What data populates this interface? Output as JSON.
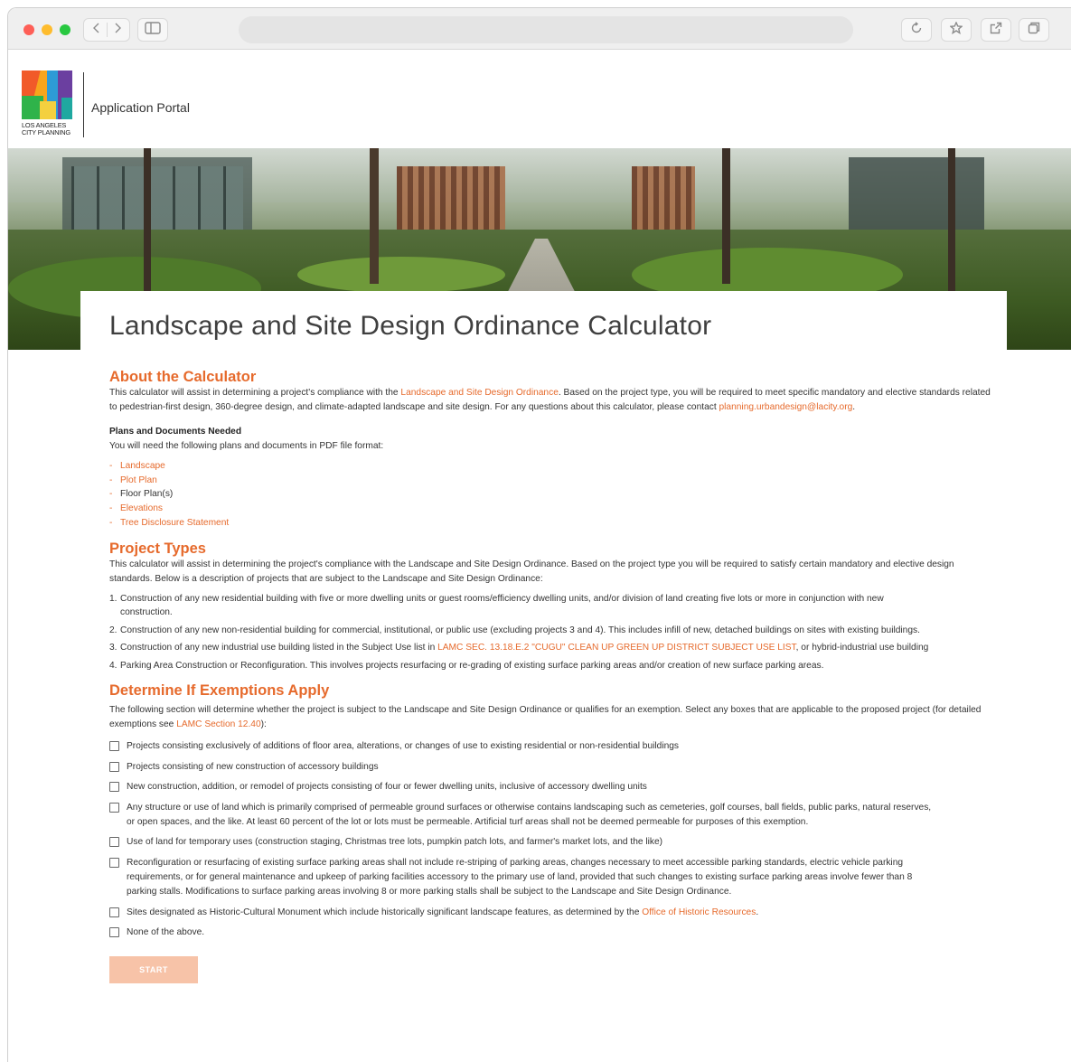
{
  "browser": {
    "icons": [
      "back-icon",
      "forward-icon",
      "sidebar-icon",
      "reload-icon",
      "bookmark-star-icon",
      "share-icon",
      "tabs-icon"
    ]
  },
  "header": {
    "logo_lines": [
      "LOS ANGELES",
      "CITY PLANNING"
    ],
    "portal_title": "Application Portal"
  },
  "page_title": "Landscape and Site Design Ordinance Calculator",
  "about": {
    "heading": "About the Calculator",
    "text_1": "This calculator will assist in determining a project's compliance with the ",
    "link_ordinance": "Landscape and Site Design Ordinance",
    "text_2": ". Based on the project type, you will be required to meet specific mandatory and elective standards related to pedestrian-first design, 360-degree design, and climate-adapted landscape and site design. For any questions about this calculator, please contact ",
    "link_email": "planning.urbandesign@lacity.org",
    "text_3": ".",
    "docs_heading": "Plans and Documents Needed",
    "docs_intro": "You will need the following plans and documents in PDF file format:",
    "docs": [
      {
        "dash": "-",
        "label": "Landscape"
      },
      {
        "dash": "-",
        "label": "Plot Plan"
      },
      {
        "dash": "-",
        "label": "Floor Plan(s)"
      },
      {
        "dash": "-",
        "label": "Elevations"
      },
      {
        "dash": "-",
        "label": "Tree Disclosure Statement"
      }
    ]
  },
  "project_types": {
    "heading": "Project Types",
    "intro": "This calculator will assist in determining the project's compliance with the Landscape and Site Design Ordinance. Based on the project type you will be required to satisfy certain mandatory and elective design standards. Below is a description of projects that are subject to the Landscape and Site Design Ordinance:",
    "items": [
      {
        "num": "1.",
        "text": "Construction of any new residential building with five or more dwelling units or guest rooms/efficiency dwelling units, and/or division of land creating five lots or more in conjunction with new construction."
      },
      {
        "num": "2.",
        "text": "Construction of any new non-residential building for commercial, institutional, or public use (excluding projects 3 and 4). This includes infill of new, detached buildings on sites with existing buildings."
      },
      {
        "num": "3.",
        "text_1": "Construction of any new industrial use building listed in the Subject Use list in ",
        "link": "LAMC SEC. 13.18.E.2  \"CUGU\" CLEAN UP GREEN UP DISTRICT SUBJECT USE LIST",
        "text_2": ", or hybrid-industrial use building"
      },
      {
        "num": "4.",
        "text": "Parking Area Construction or Reconfiguration. This involves projects resurfacing or re-grading of existing surface parking areas and/or creation of new surface parking areas."
      }
    ]
  },
  "exemptions": {
    "heading": "Determine If Exemptions Apply",
    "intro_1": "The following section will  determine whether the project is subject to the Landscape and Site Design Ordinance or qualifies for an exemption. Select any boxes that are applicable to the proposed project (for detailed exemptions see ",
    "intro_link": "LAMC Section 12.40",
    "intro_2": "):",
    "options": [
      "Projects consisting exclusively of additions of floor area, alterations, or changes of use to existing residential or non-residential buildings",
      "Projects consisting of new construction of accessory buildings",
      "New construction, addition, or remodel of projects consisting of four or fewer dwelling units, inclusive of accessory dwelling units",
      "Any structure or use of land which is primarily comprised of permeable ground surfaces or otherwise contains landscaping such as cemeteries, golf courses, ball fields, public parks, natural reserves, or open spaces, and the like. At least 60 percent of the lot or lots must be permeable. Artificial turf areas shall not be deemed permeable for purposes of this exemption.",
      "Use of land for temporary uses (construction staging, Christmas tree lots, pumpkin patch lots, and farmer's market lots, and the like)",
      "Reconfiguration or resurfacing of existing surface parking areas shall not include re-striping of parking areas, changes necessary to meet accessible parking standards, electric vehicle parking requirements, or for general maintenance and upkeep of parking facilities accessory to the primary use of land, provided that such changes to existing surface parking areas involve fewer than 8 parking stalls. Modifications to surface parking areas involving 8 or more parking stalls shall be subject to the Landscape and Site Design Ordinance."
    ],
    "historic_text": "Sites designated as Historic-Cultural Monument which include historically significant landscape features, as determined by the ",
    "historic_link": "Office of Historic Resources",
    "historic_end": ".",
    "none_option": "None of the above.",
    "start_label": "START"
  },
  "colors": {
    "accent": "#e66a2c",
    "start_disabled": "#f7c3a8"
  }
}
